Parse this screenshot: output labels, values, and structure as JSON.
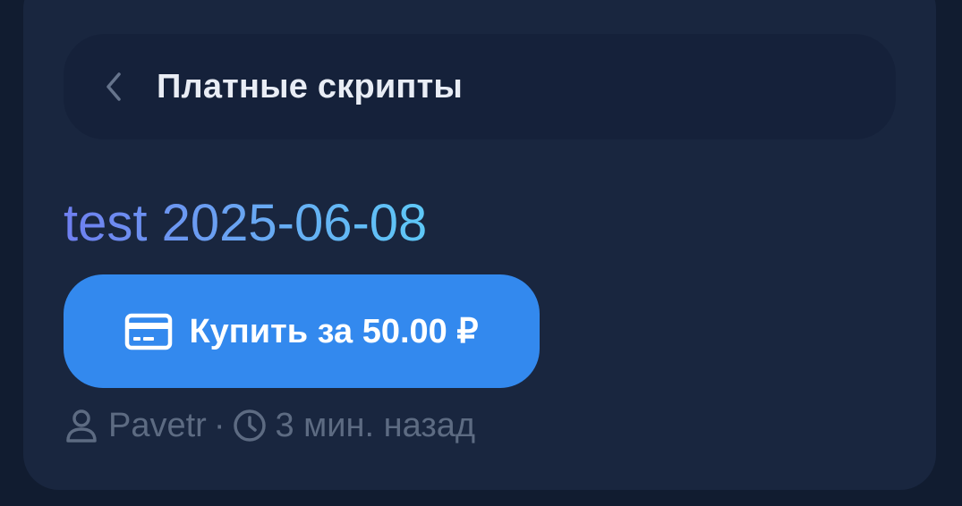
{
  "header": {
    "title": "Платные скрипты",
    "back_icon": "chevron-left-icon"
  },
  "script": {
    "title": "test 2025-06-08",
    "title_colors": [
      "#6f7ff0",
      "#5ec8f7"
    ]
  },
  "buy_button": {
    "label": "Купить за 50.00 ₽",
    "icon": "credit-card-icon",
    "color": "#3389ee"
  },
  "meta": {
    "author_icon": "user-icon",
    "author": "Pavetr",
    "separator": "·",
    "time_icon": "clock-icon",
    "time": "3 мин. назад"
  }
}
